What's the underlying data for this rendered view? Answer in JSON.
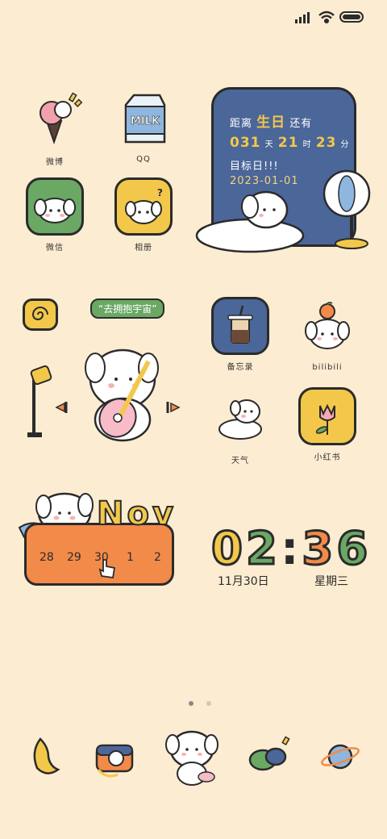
{
  "status": {
    "signal_icon": "signal-icon",
    "wifi_icon": "wifi-icon",
    "battery_icon": "battery-icon"
  },
  "apps": {
    "weibo": {
      "label": "微博"
    },
    "qq": {
      "label": "QQ"
    },
    "wechat": {
      "label": "微信"
    },
    "album": {
      "label": "相册"
    },
    "memo": {
      "label": "备忘录"
    },
    "bilibili": {
      "label": "bilibili"
    },
    "weather": {
      "label": "天气"
    },
    "xiaohongshu": {
      "label": "小红书"
    }
  },
  "birthday_widget": {
    "line1_pre": "距离",
    "line1_highlight": "生日",
    "line1_post": "还有",
    "days": "031",
    "days_unit": "天",
    "hours": "21",
    "hours_unit": "时",
    "minutes": "23",
    "minutes_unit": "分",
    "target_label": "目标日!!!",
    "target_date": "2023-01-01"
  },
  "music_widget": {
    "bubble_text": "“去拥抱宇宙”"
  },
  "calendar_widget": {
    "month": "Nov",
    "dates": [
      "28",
      "29",
      "30",
      "1",
      "2"
    ]
  },
  "clock": {
    "hour1": "0",
    "hour2": "2",
    "colon": ":",
    "min1": "3",
    "min2": "6",
    "date": "11月30日",
    "weekday": "星期三"
  },
  "colors": {
    "background": "#fcecd2",
    "blue": "#4b6699",
    "yellow": "#f3c84a",
    "green": "#6aa864",
    "orange": "#f28a4a"
  },
  "dock": {
    "icons": [
      "croissant-icon",
      "camera-icon",
      "puppy-icon",
      "chat-icon",
      "planet-icon"
    ]
  }
}
